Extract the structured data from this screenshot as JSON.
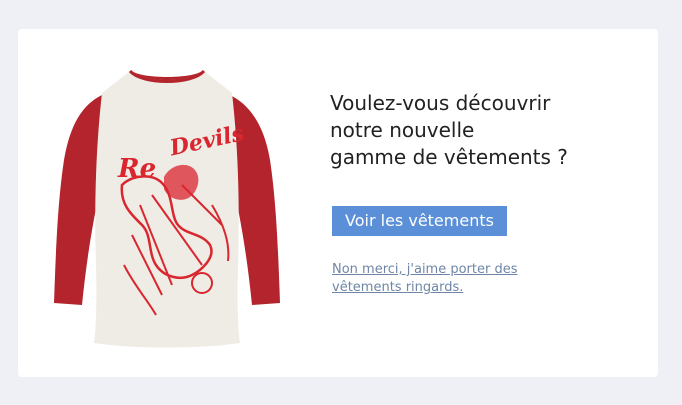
{
  "promo": {
    "headline_lines": [
      "Voulez-vous découvrir",
      "notre nouvelle",
      "gamme de vêtements ?"
    ],
    "cta_label": "Voir les vêtements",
    "decline_text": "Non merci, j'aime porter des vêtements ringards.",
    "product": {
      "print_text": "Red Devils",
      "body_color": "#efece6",
      "sleeve_color": "#b3242c",
      "print_color": "#d9262f"
    }
  },
  "colors": {
    "background": "#eef0f5",
    "card": "#ffffff",
    "button": "#5b8fd8",
    "link": "#6f86a6",
    "heading": "#222222"
  }
}
